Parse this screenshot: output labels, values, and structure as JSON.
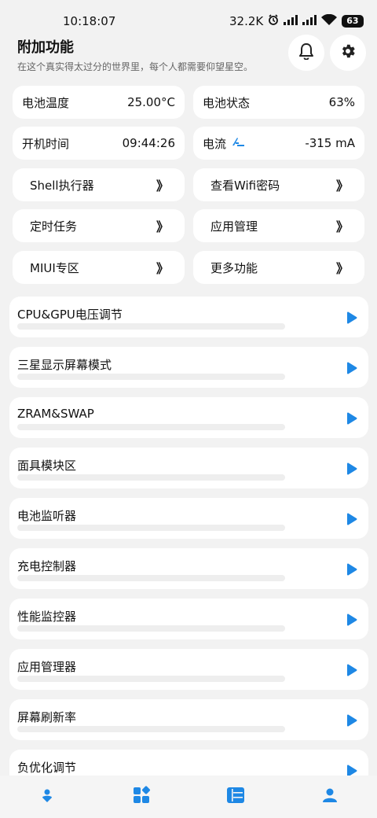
{
  "status_bar": {
    "time": "10:18:07",
    "net_speed": "32.2K",
    "battery": "63",
    "icons": [
      "alarm-icon",
      "signal-icon",
      "signal-icon",
      "wifi-icon",
      "battery-icon"
    ]
  },
  "header": {
    "title": "附加功能",
    "subtitle": "在这个真实得太过分的世界里，每个人都需要仰望星空。",
    "bell_icon": "bell-icon",
    "settings_icon": "gear-icon"
  },
  "info": {
    "battery_temp_label": "电池温度",
    "battery_temp_value": "25.00°C",
    "battery_status_label": "电池状态",
    "battery_status_value": "63%",
    "uptime_label": "开机时间",
    "uptime_value": "09:44:26",
    "current_label": "电流",
    "current_value": "-315 mA"
  },
  "shortcuts": {
    "chevron": "》",
    "shell": "Shell执行器",
    "wifi": "查看Wifi密码",
    "tasks": "定时任务",
    "apps": "应用管理",
    "miui": "MIUI专区",
    "more": "更多功能"
  },
  "features": [
    {
      "title": "CPU&GPU电压调节"
    },
    {
      "title": "三星显示屏幕模式"
    },
    {
      "title": "ZRAM&SWAP"
    },
    {
      "title": "面具模块区"
    },
    {
      "title": "电池监听器"
    },
    {
      "title": "充电控制器"
    },
    {
      "title": "性能监控器"
    },
    {
      "title": "应用管理器"
    },
    {
      "title": "屏幕刷新率"
    },
    {
      "title": "负优化调节"
    }
  ],
  "colors": {
    "accent": "#1e88e5",
    "background": "#f2f2f2",
    "card": "#ffffff"
  },
  "bottom_nav": [
    "person-pin-icon",
    "widgets-icon",
    "list-icon",
    "profile-icon"
  ]
}
